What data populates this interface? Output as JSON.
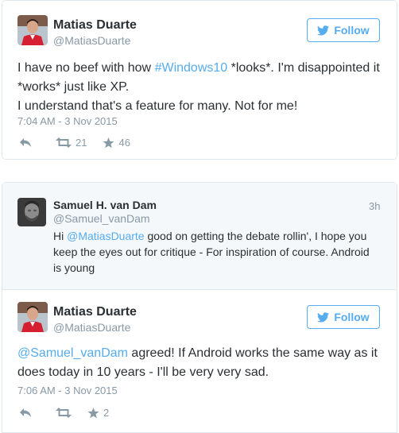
{
  "tweet1": {
    "author_name": "Matias Duarte",
    "author_handle": "@MatiasDuarte",
    "follow_label": "Follow",
    "text_before": "I have no beef with how ",
    "hashtag": "#Windows10",
    "text_line1_after": " *looks*. I'm disappointed it",
    "text_line2": "*works* just like XP.",
    "text_line3": "I understand that's a feature for many. Not for me!",
    "timestamp": "7:04 AM - 3 Nov 2015",
    "retweets": "21",
    "likes": "46"
  },
  "reply_parent": {
    "author_name": "Samuel H. van Dam",
    "author_handle": "@Samuel_vanDam",
    "time_ago": "3h",
    "text_prefix": "Hi ",
    "mention": "@MatiasDuarte",
    "text_line1_after": " good on getting the debate rollin', I hope you",
    "text_line2": "keep the eyes out for critique - For inspiration of course. Android",
    "text_line3": "is young"
  },
  "tweet2": {
    "author_name": "Matias Duarte",
    "author_handle": "@MatiasDuarte",
    "follow_label": "Follow",
    "mention": "@Samuel_vanDam",
    "text_line1_after": " agreed! If Android works the same way as it",
    "text_line2": "does today in 10 years - I'll be very very sad.",
    "timestamp": "7:06 AM - 3 Nov 2015",
    "likes": "2"
  },
  "colors": {
    "accent": "#55acee",
    "muted": "#8899a6",
    "text": "#292f33",
    "parent_bg": "#f5f8fa"
  },
  "icons": [
    "twitter-bird-icon",
    "reply-icon",
    "retweet-icon",
    "star-icon"
  ]
}
